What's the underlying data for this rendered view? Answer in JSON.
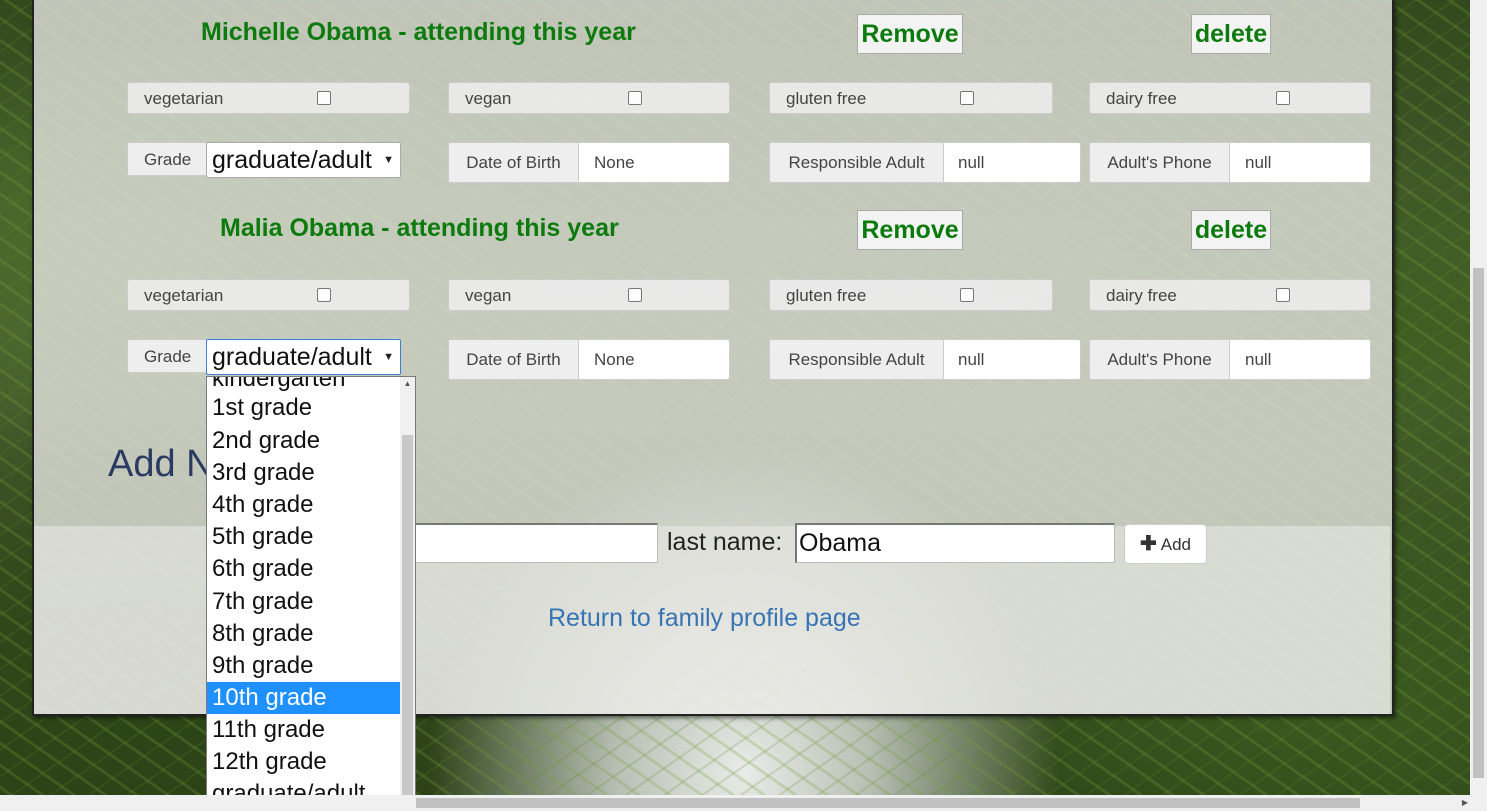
{
  "members": [
    {
      "title": "Michelle Obama - attending this year",
      "remove_label": "Remove",
      "delete_label": "delete",
      "diet": [
        "vegetarian",
        "vegan",
        "gluten free",
        "dairy free"
      ],
      "grade_label": "Grade",
      "grade_value": "graduate/adult",
      "dob_label": "Date of Birth",
      "dob_value": "None",
      "responsible_label": "Responsible Adult",
      "responsible_value": "null",
      "phone_label": "Adult's Phone",
      "phone_value": "null"
    },
    {
      "title": "Malia Obama - attending this year",
      "remove_label": "Remove",
      "delete_label": "delete",
      "diet": [
        "vegetarian",
        "vegan",
        "gluten free",
        "dairy free"
      ],
      "grade_label": "Grade",
      "grade_value": "graduate/adult",
      "dob_label": "Date of Birth",
      "dob_value": "None",
      "responsible_label": "Responsible Adult",
      "responsible_value": "null",
      "phone_label": "Adult's Phone",
      "phone_value": "null"
    }
  ],
  "add_section": {
    "heading": "Add N",
    "first_name_value": "",
    "last_name_label": "last name:",
    "last_name_value": "Obama",
    "add_button_label": "Add",
    "add_icon": "plus-icon"
  },
  "return_link": "Return to family profile page",
  "grade_options": [
    "kindergarten",
    "1st grade",
    "2nd grade",
    "3rd grade",
    "4th grade",
    "5th grade",
    "6th grade",
    "7th grade",
    "8th grade",
    "9th grade",
    "10th grade",
    "11th grade",
    "12th grade",
    "graduate/adult"
  ],
  "grade_highlighted": "10th grade",
  "colors": {
    "title_green": "#0c7a0c",
    "link_blue": "#3774b4",
    "highlight": "#1e90ff"
  }
}
